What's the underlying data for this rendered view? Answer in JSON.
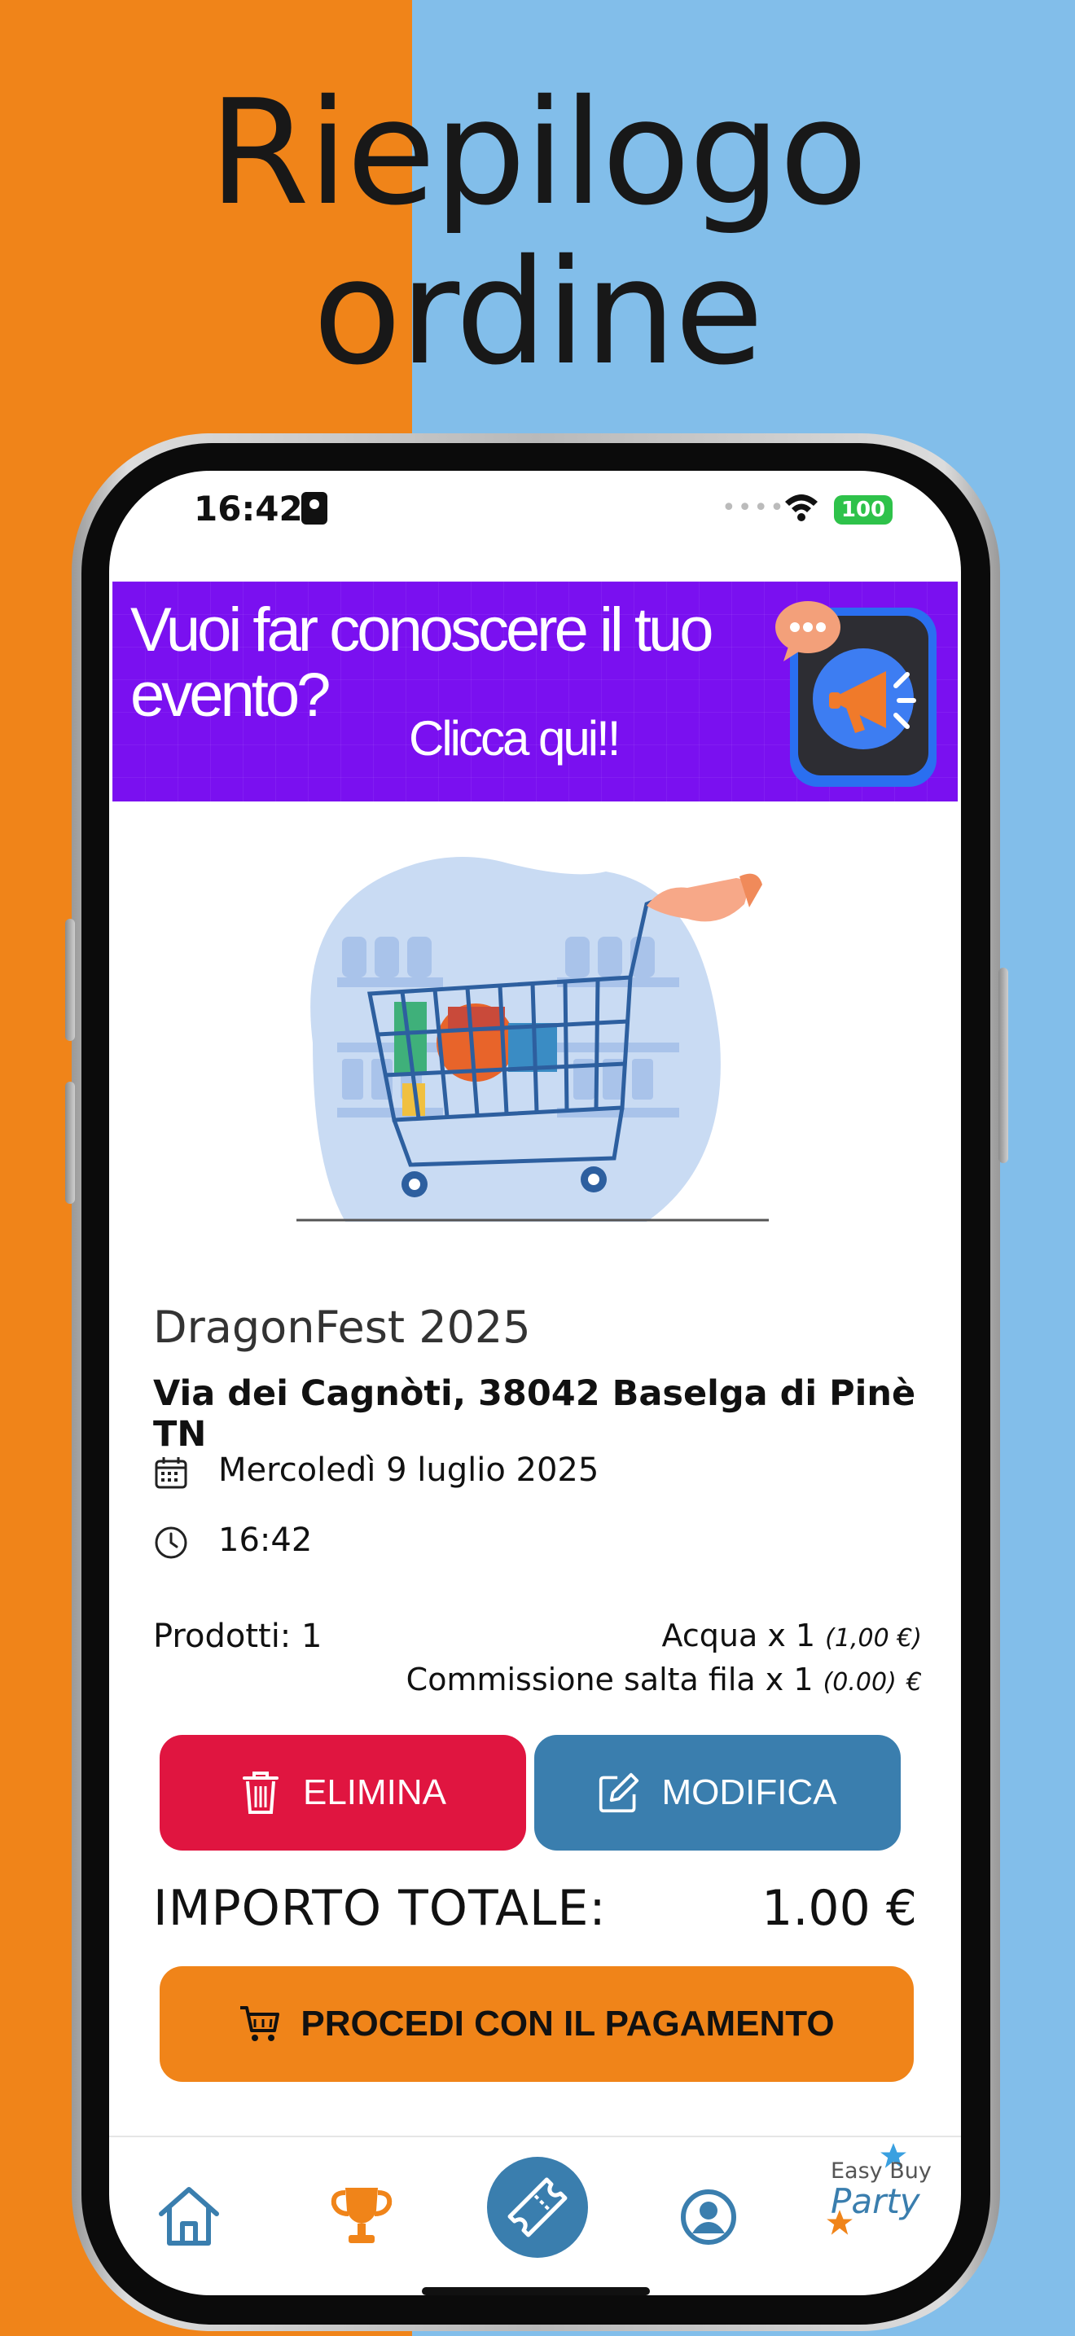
{
  "headline": {
    "line1": "Riepilogo",
    "line2": "ordine"
  },
  "status_bar": {
    "time": "16:42",
    "battery": "100"
  },
  "banner": {
    "line1": "Vuoi far conoscere il tuo",
    "line1b": "evento?",
    "line2": "Clicca qui!!"
  },
  "event": {
    "title": "DragonFest 2025",
    "address": "Via dei Cagnòti, 38042 Baselga di Pinè TN",
    "date": "Mercoledì 9 luglio 2025",
    "time": "16:42"
  },
  "order": {
    "products_label": "Prodotti: 1",
    "items": [
      {
        "name": "Acqua x 1",
        "price": "(1,00 €)",
        "suffix": ""
      },
      {
        "name": "Commissione salta fila x 1",
        "price": "(0.00)",
        "suffix": "€"
      }
    ]
  },
  "actions": {
    "delete_label": "ELIMINA",
    "edit_label": "MODIFICA",
    "pay_label": "PROCEDI CON IL PAGAMENTO"
  },
  "total": {
    "label": "IMPORTO TOTALE:",
    "value": "1.00 €"
  },
  "nav": {
    "logo_line1": "Easy Buy",
    "logo_line2": "Party"
  },
  "icons": [
    "calendar-icon",
    "clock-icon",
    "trash-icon",
    "edit-icon",
    "cart-icon",
    "home-icon",
    "trophy-icon",
    "ticket-icon",
    "profile-icon",
    "star-icon",
    "megaphone-icon",
    "wifi-icon"
  ],
  "colors": {
    "orange": "#f08419",
    "sky": "#82beea",
    "banner_purple": "#7a10f0",
    "delete_red": "#e01540",
    "edit_blue": "#3a7eae"
  }
}
